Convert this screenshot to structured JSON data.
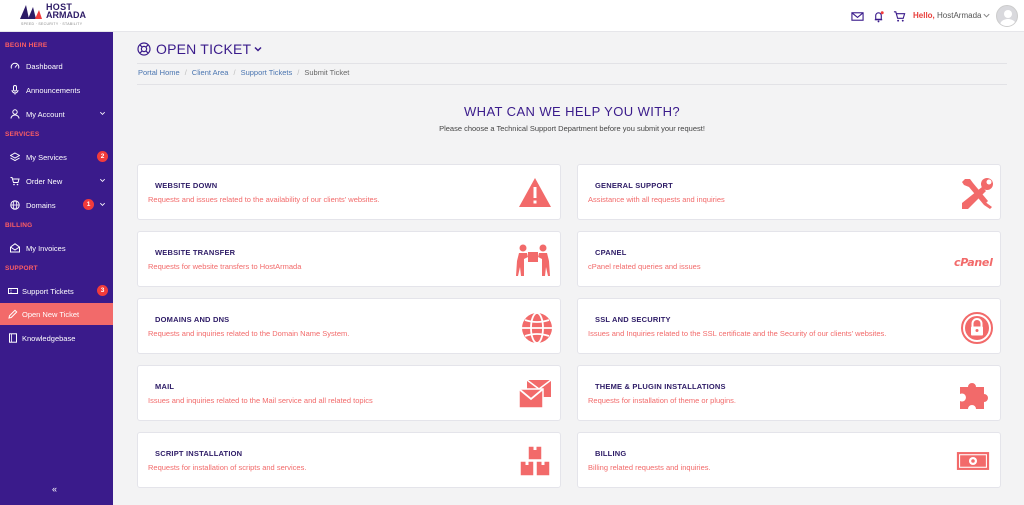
{
  "brand": {
    "name_top": "HOST",
    "name_bottom": "ARMADA",
    "tagline": "SPEED · SECURITY · STABILITY"
  },
  "header": {
    "greeting": "Hello,",
    "user_name": "HostArmada",
    "icons": [
      "mail-icon",
      "notification-bell-icon",
      "cart-icon",
      "chevron-down-icon",
      "avatar"
    ]
  },
  "sidebar": {
    "sections": {
      "begin": "BEGIN HERE",
      "services": "SERVICES",
      "billing": "BILLING",
      "support": "SUPPORT"
    },
    "items": [
      {
        "label": "Dashboard",
        "icon": "dashboard-gauge-icon"
      },
      {
        "label": "Announcements",
        "icon": "microphone-icon"
      },
      {
        "label": "My Account",
        "icon": "user-icon"
      },
      {
        "label": "My Services",
        "icon": "layers-icon",
        "badge": "2"
      },
      {
        "label": "Order New",
        "icon": "cart-icon"
      },
      {
        "label": "Domains",
        "icon": "globe-icon",
        "badge": "1"
      },
      {
        "label": "My Invoices",
        "icon": "envelope-open-icon"
      },
      {
        "label": "Support Tickets",
        "icon": "ticket-icon",
        "badge": "3"
      },
      {
        "label": "Open New Ticket",
        "icon": "pencil-icon"
      },
      {
        "label": "Knowledgebase",
        "icon": "book-icon"
      }
    ],
    "collapse": "«",
    "colors": {
      "background": "#3a1b8b",
      "active": "#f26a6a",
      "section_head": "#ff5e63",
      "badge": "#f23b3b"
    }
  },
  "page": {
    "title": "OPEN TICKET",
    "breadcrumbs": [
      "Portal Home",
      "Client Area",
      "Support Tickets",
      "Submit Ticket"
    ],
    "heading": "WHAT CAN WE HELP YOU WITH?",
    "subheading": "Please choose a Technical Support Department before you submit your request!"
  },
  "departments": [
    {
      "title": "WEBSITE DOWN",
      "desc": "Requests and issues related to the availability of our clients' websites.",
      "icon": "warning-triangle-icon"
    },
    {
      "title": "GENERAL SUPPORT",
      "desc": "Assistance with all requests and inquiries",
      "icon": "wrench-screwdriver-icon"
    },
    {
      "title": "WEBSITE TRANSFER",
      "desc": "Requests for website transfers to HostArmada",
      "icon": "people-carrying-box-icon"
    },
    {
      "title": "CPANEL",
      "desc": "cPanel related queries and issues",
      "icon": "cpanel-logo-icon",
      "icon_text": "cPanel"
    },
    {
      "title": "DOMAINS AND DNS",
      "desc": "Requests and inquiries related to the Domain Name System.",
      "icon": "globe-icon"
    },
    {
      "title": "SSL AND SECURITY",
      "desc": "Issues and Inquiries related to the SSL certificate and the Security of our clients' websites.",
      "icon": "padlock-icon"
    },
    {
      "title": "MAIL",
      "desc": "Issues and inquiries related to the Mail service and all related topics",
      "icon": "envelopes-icon"
    },
    {
      "title": "THEME & PLUGIN INSTALLATIONS",
      "desc": "Requests for installation of theme or plugins.",
      "icon": "puzzle-piece-icon"
    },
    {
      "title": "SCRIPT INSTALLATION",
      "desc": "Requests for installation of scripts and services.",
      "icon": "stacked-boxes-icon"
    },
    {
      "title": "BILLING",
      "desc": "Billing related requests and inquiries.",
      "icon": "banknote-icon"
    }
  ],
  "colors": {
    "accent": "#f26a6a",
    "title": "#3a1b8b",
    "link": "#4a75b0"
  }
}
